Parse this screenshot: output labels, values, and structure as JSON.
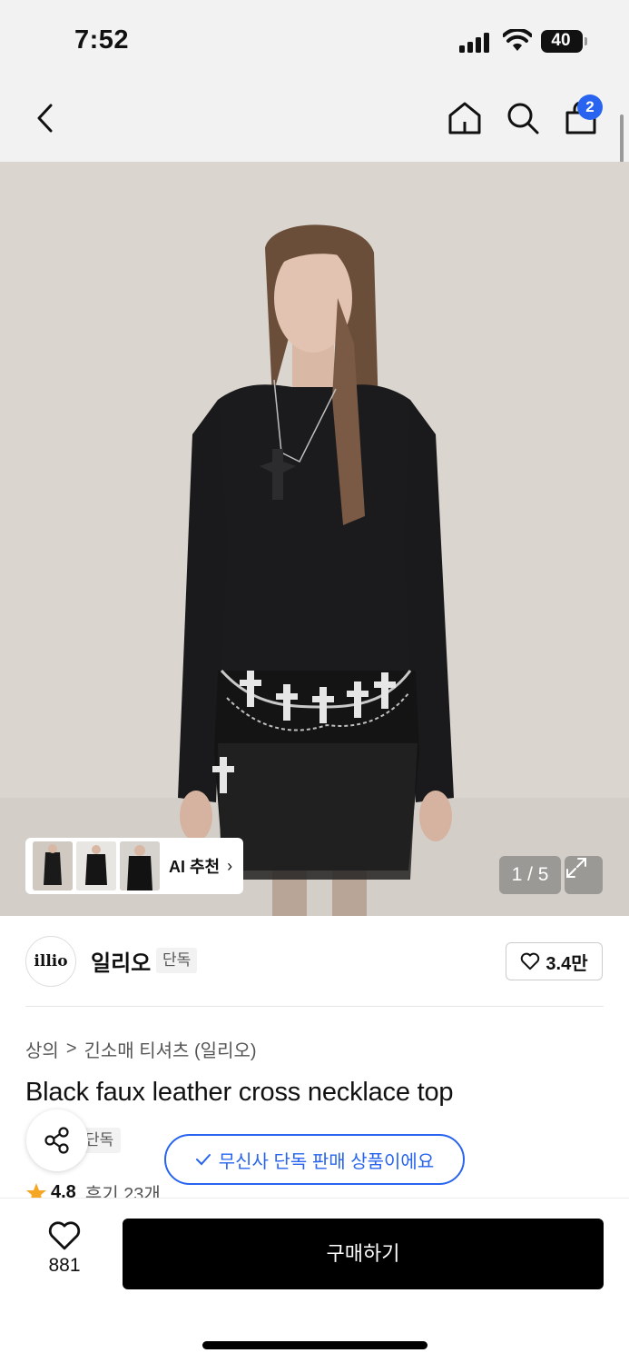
{
  "status_bar": {
    "time": "7:52",
    "battery": "40"
  },
  "header": {
    "cart_count": "2",
    "icons": [
      "back-icon",
      "home-icon",
      "search-icon",
      "bag-icon"
    ]
  },
  "gallery": {
    "ai_label": "AI 추천",
    "ai_chevron": "›",
    "pager": "1 / 5"
  },
  "brand": {
    "logo_text": "illio",
    "name": "일리오",
    "tag": "단독",
    "likes": "3.4만"
  },
  "breadcrumb": {
    "category": "상의",
    "separator": ">",
    "subcategory": "긴소매 티셔츠 (일리오)"
  },
  "product": {
    "title": "Black faux leather cross necklace top",
    "exclusive_tag": "단독",
    "rating": "4.8",
    "reviews": "후기 23개"
  },
  "toast": {
    "text": "무신사 단독 판매 상품이에요"
  },
  "bottom_bar": {
    "wish_count": "881",
    "buy_label": "구매하기"
  },
  "colors": {
    "accent": "#2864f0",
    "buy_button": "#000000",
    "star": "#f5a623"
  }
}
